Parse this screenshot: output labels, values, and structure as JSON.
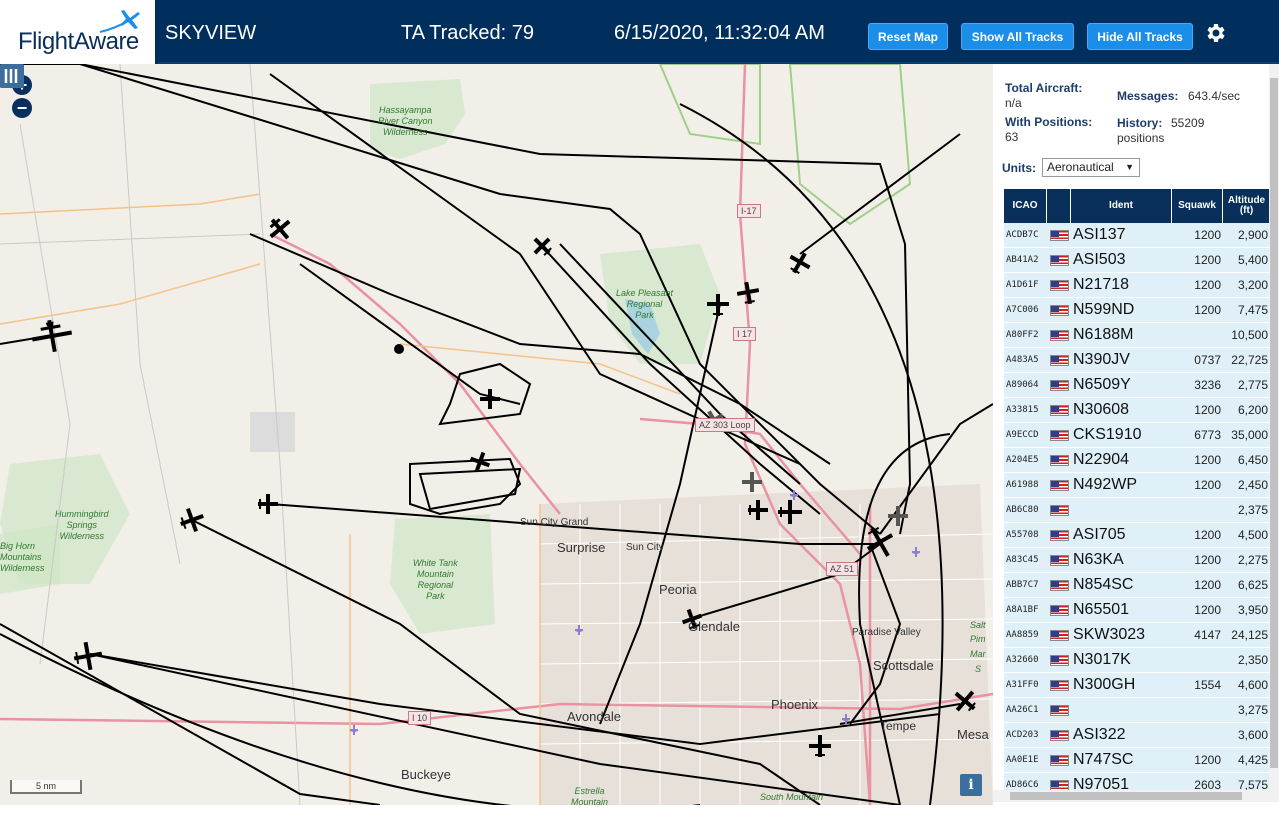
{
  "header": {
    "logo_text": "FlightAware",
    "app_name": "SKYVIEW",
    "ta_tracked": "TA Tracked: 79",
    "datetime": "6/15/2020, 11:32:04 AM",
    "buttons": {
      "reset": "Reset Map",
      "show_all": "Show All Tracks",
      "hide_all": "Hide All Tracks"
    },
    "settings_icon": "gear-icon"
  },
  "map": {
    "zoom_in": "+",
    "zoom_out": "−",
    "scale": "5 nm",
    "info": "i",
    "labels": {
      "surprise": "Surprise",
      "sun_city": "Sun City",
      "sun_city_grand": "Sun City Grand",
      "peoria": "Peoria",
      "glendale": "Glendale",
      "scottsdale": "Scottsdale",
      "paradise_valley": "Paradise Valley",
      "phoenix": "Phoenix",
      "tempe": "Tempe",
      "mesa": "Mesa",
      "avondale": "Avondale",
      "buckeye": "Buckeye",
      "salt": "Salt",
      "pima": "Pim",
      "mar": "Mar",
      "s": "S"
    },
    "parks": {
      "hassayampa": [
        "Hassayampa",
        "River Canyon",
        "Wilderness"
      ],
      "lake_pleasant": [
        "Lake Pleasant",
        "Regional",
        "Park"
      ],
      "white_tank": [
        "White Tank",
        "Mountain",
        "Regional",
        "Park"
      ],
      "hummingbird": [
        "Hummingbird",
        "Springs",
        "Wilderness"
      ],
      "big_horn": [
        "Big Horn",
        "Mountains",
        "Wilderness"
      ],
      "estrella": [
        "Estrella",
        "Mountain"
      ],
      "south_mountain": "South Mountain"
    },
    "shields": {
      "i17a": "I-17",
      "i17b": "I 17",
      "az303": "AZ 303 Loop",
      "az51": "AZ 51",
      "i10": "I 10"
    }
  },
  "panel": {
    "total_aircraft_label": "Total Aircraft:",
    "total_aircraft_value": "n/a",
    "with_positions_label": "With Positions:",
    "with_positions_value": "63",
    "messages_label": "Messages:",
    "messages_value": "643.4/sec",
    "history_label": "History:",
    "history_value": "55209",
    "history_unit": "positions",
    "units_label": "Units:",
    "units_value": "Aeronautical",
    "columns": {
      "icao": "ICAO",
      "ident": "Ident",
      "squawk": "Squawk",
      "altitude": "Altitude (ft)"
    },
    "rows": [
      {
        "icao": "ACDB7C",
        "ident": "ASI137",
        "squawk": "1200",
        "alt": "2,900"
      },
      {
        "icao": "AB41A2",
        "ident": "ASI503",
        "squawk": "1200",
        "alt": "5,400"
      },
      {
        "icao": "A1D61F",
        "ident": "N21718",
        "squawk": "1200",
        "alt": "3,200"
      },
      {
        "icao": "A7C006",
        "ident": "N599ND",
        "squawk": "1200",
        "alt": "7,475"
      },
      {
        "icao": "A80FF2",
        "ident": "N6188M",
        "squawk": "",
        "alt": "10,500"
      },
      {
        "icao": "A483A5",
        "ident": "N390JV",
        "squawk": "0737",
        "alt": "22,725"
      },
      {
        "icao": "A89064",
        "ident": "N6509Y",
        "squawk": "3236",
        "alt": "2,775"
      },
      {
        "icao": "A33815",
        "ident": "N30608",
        "squawk": "1200",
        "alt": "6,200"
      },
      {
        "icao": "A9ECCD",
        "ident": "CKS1910",
        "squawk": "6773",
        "alt": "35,000"
      },
      {
        "icao": "A204E5",
        "ident": "N22904",
        "squawk": "1200",
        "alt": "6,450"
      },
      {
        "icao": "A61988",
        "ident": "N492WP",
        "squawk": "1200",
        "alt": "2,450"
      },
      {
        "icao": "AB6C80",
        "ident": "",
        "squawk": "",
        "alt": "2,375"
      },
      {
        "icao": "A55708",
        "ident": "ASI705",
        "squawk": "1200",
        "alt": "4,500"
      },
      {
        "icao": "A83C45",
        "ident": "N63KA",
        "squawk": "1200",
        "alt": "2,275"
      },
      {
        "icao": "ABB7C7",
        "ident": "N854SC",
        "squawk": "1200",
        "alt": "6,625"
      },
      {
        "icao": "A8A1BF",
        "ident": "N65501",
        "squawk": "1200",
        "alt": "3,950"
      },
      {
        "icao": "AA8859",
        "ident": "SKW3023",
        "squawk": "4147",
        "alt": "24,125"
      },
      {
        "icao": "A32660",
        "ident": "N3017K",
        "squawk": "",
        "alt": "2,350"
      },
      {
        "icao": "A31FF0",
        "ident": "N300GH",
        "squawk": "1554",
        "alt": "4,600"
      },
      {
        "icao": "AA26C1",
        "ident": "",
        "squawk": "",
        "alt": "3,275"
      },
      {
        "icao": "ACD203",
        "ident": "ASI322",
        "squawk": "",
        "alt": "3,600"
      },
      {
        "icao": "AA0E1E",
        "ident": "N747SC",
        "squawk": "1200",
        "alt": "4,425"
      },
      {
        "icao": "AD86C6",
        "ident": "N97051",
        "squawk": "2603",
        "alt": "7,575"
      }
    ]
  },
  "colors": {
    "header_bg": "#002f5d",
    "button_bg": "#1a8ee9",
    "table_header_bg": "#08305b",
    "row_bg": "#dff0f8",
    "map_bg": "#f2efe9",
    "track": "#000000"
  }
}
